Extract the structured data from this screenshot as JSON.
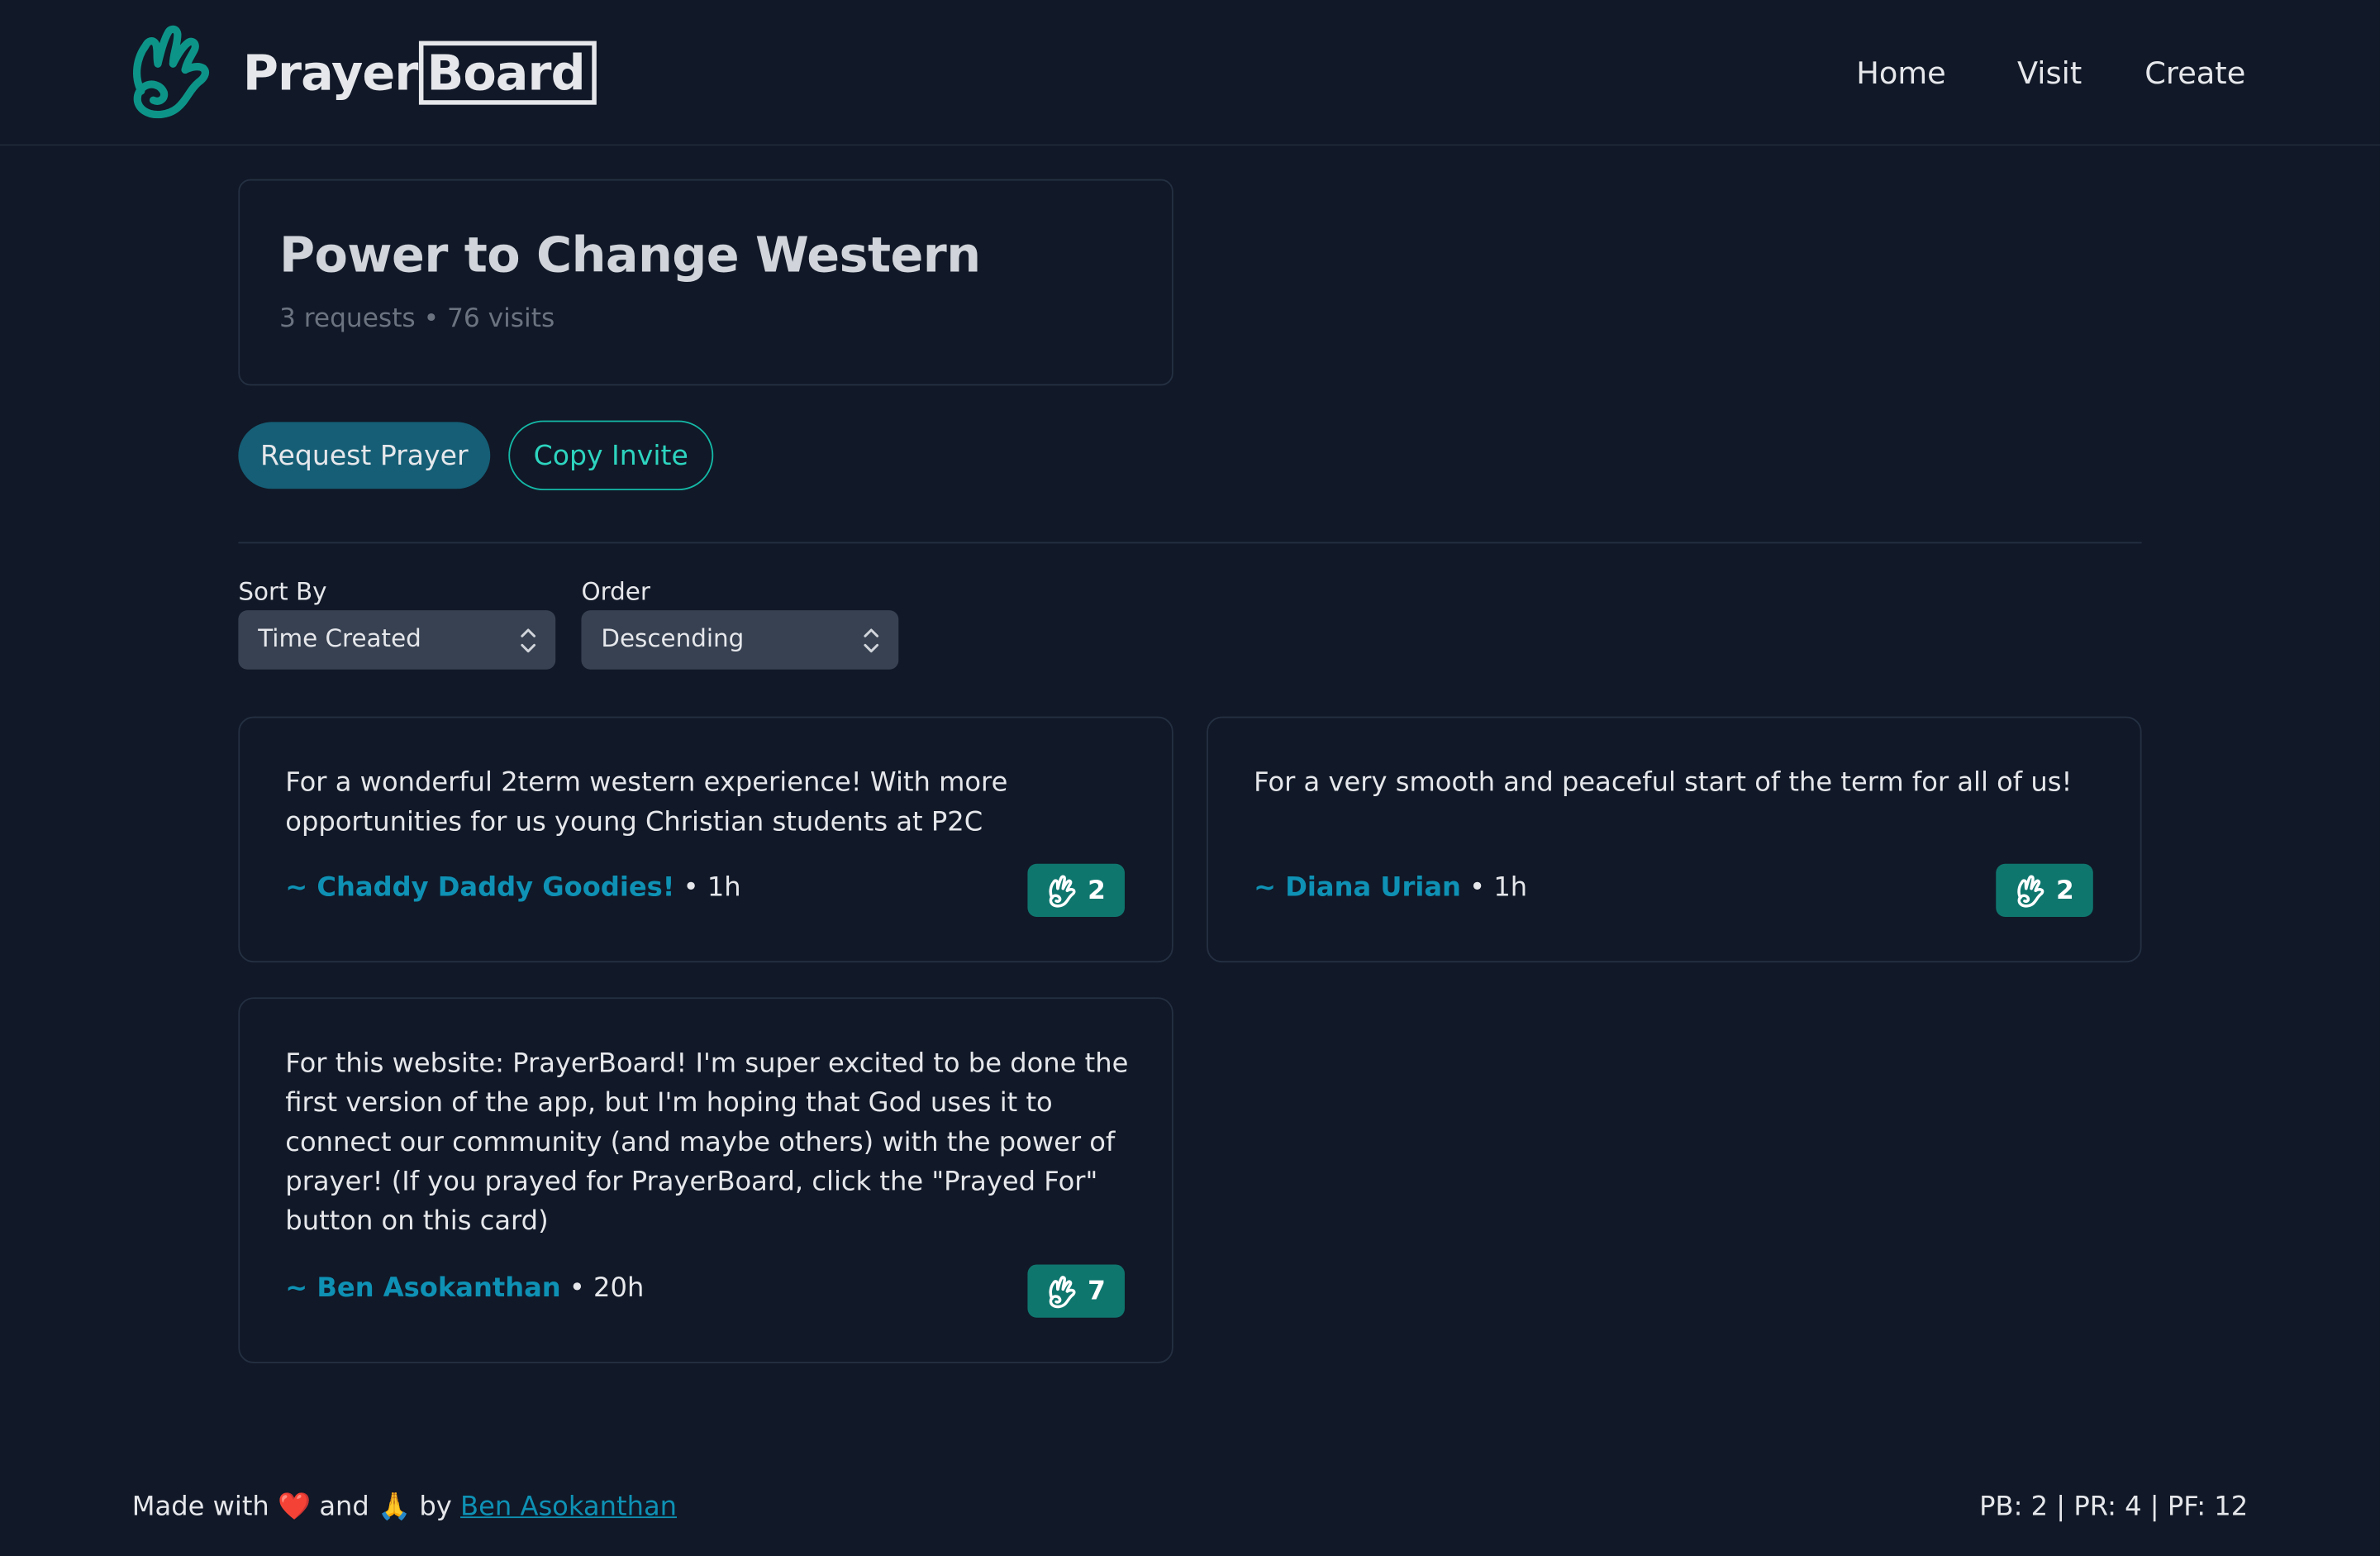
{
  "header": {
    "brand_part1": "Prayer",
    "brand_part2": "Board",
    "nav": [
      "Home",
      "Visit",
      "Create"
    ]
  },
  "board": {
    "title": "Power to Change Western",
    "meta": "3 requests • 76 visits"
  },
  "actions": {
    "request_label": "Request Prayer",
    "invite_label": "Copy Invite"
  },
  "controls": {
    "sort_label": "Sort By",
    "sort_value": "Time Created",
    "order_label": "Order",
    "order_value": "Descending"
  },
  "prayers": [
    {
      "text": "For a wonderful 2term western experience! With more opportunities for us young Christian students at P2C",
      "author": "~ Chaddy Daddy Goodies!",
      "age": " • 1h",
      "count": "2"
    },
    {
      "text": "For a very smooth and peaceful start of the term for all of us!",
      "author": "~ Diana Urian",
      "age": " • 1h",
      "count": "2"
    },
    {
      "text": "For this website: PrayerBoard! I'm super excited to be done the first version of the app, but I'm hoping that God uses it to connect our community (and maybe others) with the power of prayer! (If you prayed for PrayerBoard, click the \"Prayed For\" button on this card)",
      "author": "~ Ben Asokanthan",
      "age": " • 20h",
      "count": "7"
    }
  ],
  "footer": {
    "made_with": "Made with",
    "heart": "❤️",
    "and": "and",
    "pray": "🙏",
    "by": "by",
    "author_link": "Ben Asokanthan",
    "stats": "PB: 2 | PR: 4 | PF: 12"
  },
  "colors": {
    "background": "#111827",
    "brand_teal": "#14b8a6",
    "primary_button": "#155e75",
    "prayed_button": "#0f766e",
    "author_link": "#0e91b4"
  },
  "icons": {
    "logo": "praying-hand-icon",
    "prayed": "praying-hand-icon",
    "select": "chevron-up-down-icon"
  }
}
